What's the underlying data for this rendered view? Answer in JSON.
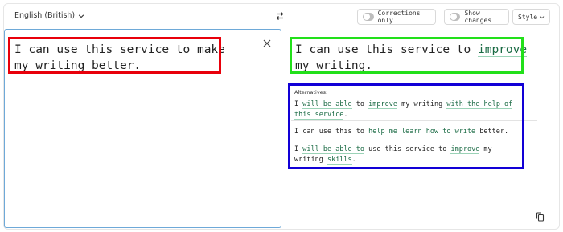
{
  "header": {
    "language_label": "English (British)",
    "corrections_only_label": "Corrections only",
    "show_changes_label": "Show changes",
    "style_label": "Style"
  },
  "input": {
    "text": "I can use this service to make my writing better."
  },
  "output": {
    "before": "I can use this service to ",
    "changed": "improve",
    "after": " my writing."
  },
  "alternatives": {
    "title": "Alternatives:",
    "items": [
      [
        {
          "t": "I ",
          "c": false
        },
        {
          "t": "will be able",
          "c": true
        },
        {
          "t": " to ",
          "c": false
        },
        {
          "t": "improve",
          "c": true
        },
        {
          "t": " my writing ",
          "c": false
        },
        {
          "t": "with the help of this service",
          "c": true
        },
        {
          "t": ".",
          "c": false
        }
      ],
      [
        {
          "t": "I can use this to ",
          "c": false
        },
        {
          "t": "help me learn how to write",
          "c": true
        },
        {
          "t": " better.",
          "c": false
        }
      ],
      [
        {
          "t": "I ",
          "c": false
        },
        {
          "t": "will be able to",
          "c": true
        },
        {
          "t": " use this service to ",
          "c": false
        },
        {
          "t": "improve",
          "c": true
        },
        {
          "t": " my writing ",
          "c": false
        },
        {
          "t": "skills",
          "c": true
        },
        {
          "t": ".",
          "c": false
        }
      ]
    ]
  },
  "colors": {
    "highlight_red": "#e8000b",
    "highlight_green": "#22e01a",
    "highlight_blue": "#1200d6",
    "change_text": "#1b6b45",
    "change_underline": "#9bd3b7",
    "input_border": "#6ea9d8"
  },
  "icons": [
    "chevron-down-icon",
    "swap-icon",
    "close-icon",
    "copy-icon"
  ]
}
